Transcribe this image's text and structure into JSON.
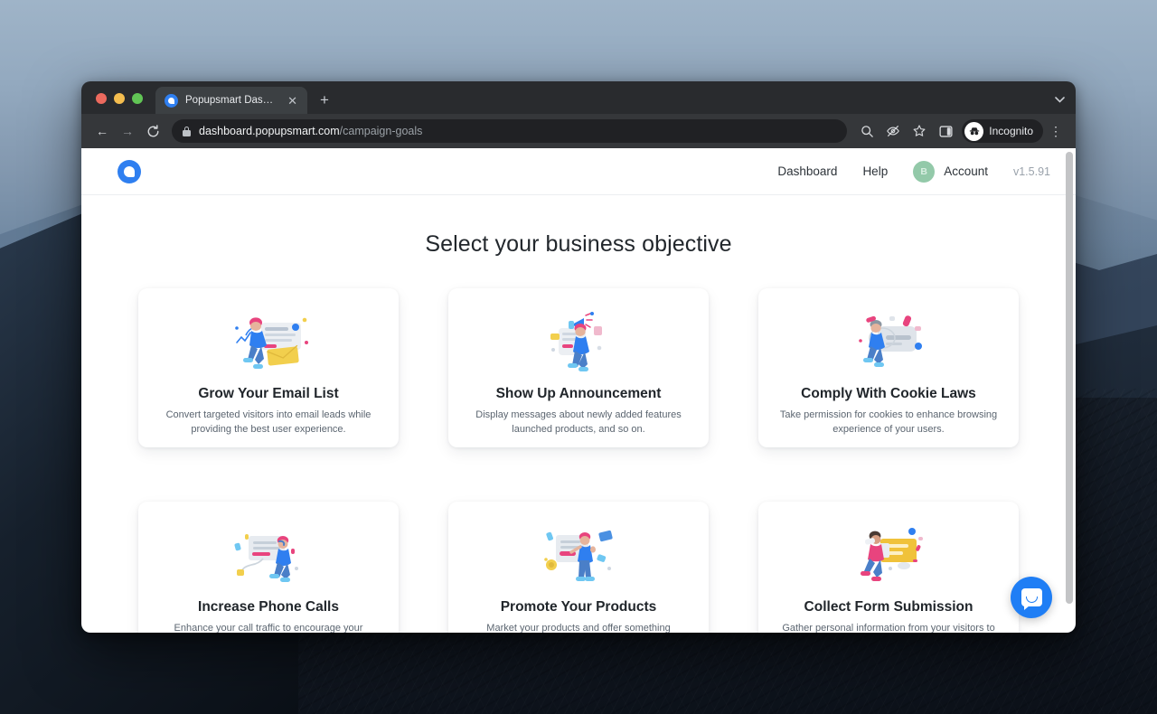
{
  "desktop": {
    "wallpaper_name": "mountain-wallpaper"
  },
  "browser": {
    "traffic_lights": [
      "close",
      "minimize",
      "maximize"
    ],
    "tab": {
      "title": "Popupsmart Dashboard",
      "favicon_name": "popupsmart-favicon",
      "close_label": "✕"
    },
    "new_tab_label": "+",
    "tab_search_label": "⌄",
    "nav": {
      "back": "←",
      "forward": "→",
      "reload": "⟳"
    },
    "omnibox": {
      "domain": "dashboard.popupsmart.com",
      "path": "/campaign-goals",
      "lock_icon": "lock-icon"
    },
    "toolbar_icons": [
      "search-icon",
      "eye-off-icon",
      "star-icon",
      "side-panel-icon"
    ],
    "profile": {
      "label": "Incognito",
      "icon": "incognito-icon"
    },
    "menu_label": "⋮"
  },
  "app": {
    "logo_name": "popupsmart-logo",
    "nav": [
      {
        "label": "Dashboard"
      },
      {
        "label": "Help"
      }
    ],
    "account": {
      "avatar_letter": "B",
      "label": "Account"
    },
    "version": "v1.5.91"
  },
  "main": {
    "title": "Select your business objective",
    "cards": [
      {
        "illustration": "person-running-with-email-card",
        "title": "Grow Your Email List",
        "description": "Convert targeted visitors into email leads while providing the best user experience."
      },
      {
        "illustration": "person-with-megaphone",
        "title": "Show Up Announcement",
        "description": "Display messages about newly added features launched products, and so on."
      },
      {
        "illustration": "person-with-cookie-banner",
        "title": "Comply With Cookie Laws",
        "description": "Take permission for cookies to enhance browsing experience of your users."
      },
      {
        "illustration": "person-on-phone-call",
        "title": "Increase Phone Calls",
        "description": "Enhance your call traffic to encourage your traditional-minded users to buy online."
      },
      {
        "illustration": "person-presenting-product-board",
        "title": "Promote Your Products",
        "description": "Market your products and offer something irresistible to have the desired action."
      },
      {
        "illustration": "person-carrying-form",
        "title": "Collect Form Submission",
        "description": "Gather personal information from your visitors to segment engagement activities."
      }
    ]
  },
  "widgets": {
    "chat_button_name": "intercom-chat-button"
  },
  "colors": {
    "brand_blue": "#2f7ff0",
    "intercom_blue": "#1f7ef5",
    "avatar_green": "#93c9a9",
    "page_bg": "#ffffff",
    "chrome_dark": "#35373a"
  }
}
